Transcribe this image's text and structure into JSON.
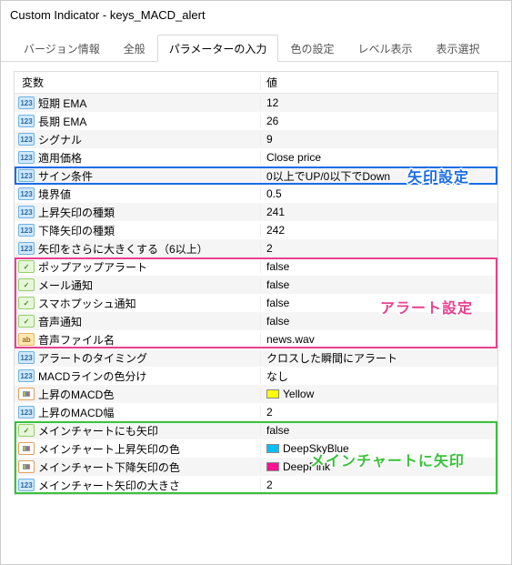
{
  "window": {
    "title": "Custom Indicator - keys_MACD_alert"
  },
  "tabs": {
    "version": "バージョン情報",
    "general": "全般",
    "params": "パラメーターの入力",
    "colors": "色の設定",
    "levels": "レベル表示",
    "display": "表示選択"
  },
  "grid": {
    "head_var": "変数",
    "head_val": "値",
    "rows": [
      {
        "icon": "num",
        "name": "短期 EMA",
        "value": "12"
      },
      {
        "icon": "num",
        "name": "長期 EMA",
        "value": "26"
      },
      {
        "icon": "num",
        "name": "シグナル",
        "value": "9"
      },
      {
        "icon": "num",
        "name": "適用価格",
        "value": "Close price"
      },
      {
        "icon": "num",
        "name": "サイン条件",
        "value": "0以上でUP/0以下でDown"
      },
      {
        "icon": "num",
        "name": "境界値",
        "value": "0.5"
      },
      {
        "icon": "num",
        "name": "上昇矢印の種類",
        "value": "241"
      },
      {
        "icon": "num",
        "name": "下降矢印の種類",
        "value": "242"
      },
      {
        "icon": "num",
        "name": "矢印をさらに大きくする（6以上）",
        "value": "2"
      },
      {
        "icon": "sign",
        "name": "ポップアップアラート",
        "value": "false"
      },
      {
        "icon": "sign",
        "name": "メール通知",
        "value": "false"
      },
      {
        "icon": "sign",
        "name": "スマホプッシュ通知",
        "value": "false"
      },
      {
        "icon": "sign",
        "name": "音声通知",
        "value": "false"
      },
      {
        "icon": "ab",
        "name": "音声ファイル名",
        "value": "news.wav"
      },
      {
        "icon": "num",
        "name": "アラートのタイミング",
        "value": "クロスした瞬間にアラート"
      },
      {
        "icon": "num",
        "name": "MACDラインの色分け",
        "value": "なし"
      },
      {
        "icon": "color",
        "name": "上昇のMACD色",
        "value": "Yellow",
        "swatch": "#ffff00"
      },
      {
        "icon": "num",
        "name": "上昇のMACD幅",
        "value": "2"
      },
      {
        "icon": "sign",
        "name": "メインチャートにも矢印",
        "value": "false"
      },
      {
        "icon": "color",
        "name": "メインチャート上昇矢印の色",
        "value": "DeepSkyBlue",
        "swatch": "#00bfff"
      },
      {
        "icon": "color",
        "name": "メインチャート下降矢印の色",
        "value": "DeepPink",
        "swatch": "#ff1493"
      },
      {
        "icon": "num",
        "name": "メインチャート矢印の大きさ",
        "value": "2"
      }
    ]
  },
  "annotations": {
    "arrow_settings": "矢印設定",
    "alert_settings": "アラート設定",
    "mainchart_arrows": "メインチャートに矢印"
  }
}
